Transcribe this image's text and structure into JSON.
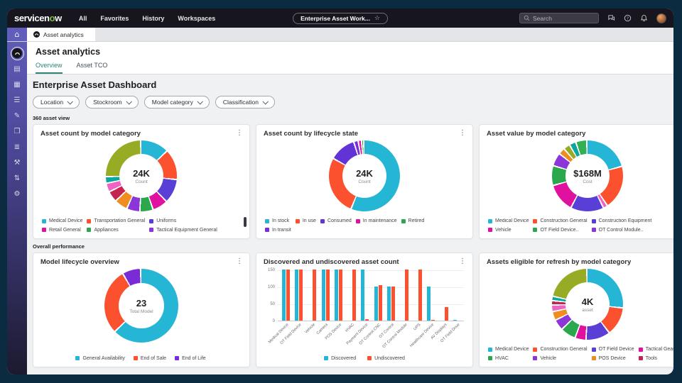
{
  "header": {
    "logo_pre": "servicen",
    "logo_o": "o",
    "logo_post": "w",
    "nav_items": [
      "All",
      "Favorites",
      "History",
      "Workspaces"
    ],
    "workspace_pill": "Enterprise Asset Work...",
    "search_placeholder": "Search",
    "right_icons": [
      "chat",
      "help",
      "notifications"
    ]
  },
  "tab_strip": {
    "active_tab": "Asset analytics"
  },
  "sidebar": {
    "items": [
      {
        "name": "asset-analytics-app",
        "type": "app"
      },
      {
        "name": "forms",
        "glyph": "▤"
      },
      {
        "name": "tasks",
        "glyph": "▦"
      },
      {
        "name": "sliders",
        "glyph": "☰"
      },
      {
        "name": "compose",
        "glyph": "✎"
      },
      {
        "name": "knowledge",
        "glyph": "❒"
      },
      {
        "name": "lists",
        "glyph": "≣"
      },
      {
        "name": "tools",
        "glyph": "⚒"
      },
      {
        "name": "transfers",
        "glyph": "⇅"
      },
      {
        "name": "settings",
        "glyph": "⚙"
      }
    ]
  },
  "icons": {
    "kebab": "⋮",
    "star": "☆",
    "home": "⌂"
  },
  "colors": {
    "frame": "#0B2B40",
    "header_bg": "#17161E",
    "accent_teal": "#2E8575",
    "cyan": "#25B6D6",
    "red": "#FB512F"
  },
  "page": {
    "title": "Asset analytics",
    "tabs": [
      {
        "label": "Overview",
        "active": true
      },
      {
        "label": "Asset TCO",
        "active": false
      }
    ],
    "dashboard_title": "Enterprise Asset Dashboard",
    "filters": [
      "Location",
      "Stockroom",
      "Model category",
      "Classification"
    ],
    "sections": [
      "360 asset view",
      "Overall performance"
    ]
  },
  "cards": [
    {
      "row": 1,
      "title": "Asset count by model category",
      "scrollbar": true,
      "chart_data": {
        "type": "donut",
        "center_value": "24K",
        "center_label": "Count",
        "size": 100,
        "segments": [
          {
            "color": "#25B6D6",
            "value": 13
          },
          {
            "color": "#FB512F",
            "value": 14
          },
          {
            "color": "#5A3FD6",
            "value": 11
          },
          {
            "color": "#E0119E",
            "value": 7
          },
          {
            "color": "#2BA84E",
            "value": 6
          },
          {
            "color": "#8A36D9",
            "value": 6
          },
          {
            "color": "#EF8D20",
            "value": 6
          },
          {
            "color": "#C2254F",
            "value": 5
          },
          {
            "color": "#EF63C2",
            "value": 4
          },
          {
            "color": "#0AA79F",
            "value": 3
          },
          {
            "color": "#97AB24",
            "value": 25
          }
        ],
        "legend_cols": 3,
        "legend": [
          {
            "label": "Medical Device",
            "color": "#25B6D6"
          },
          {
            "label": "Transportation General",
            "color": "#FB512F"
          },
          {
            "label": "Uniforms",
            "color": "#5A3FD6"
          },
          {
            "label": "Retail General",
            "color": "#E0119E"
          },
          {
            "label": "Appliances",
            "color": "#2BA84E"
          },
          {
            "label": "Tactical Equipment General",
            "color": "#8A36D9"
          }
        ]
      }
    },
    {
      "row": 1,
      "title": "Asset count by lifecycle state",
      "scrollbar": false,
      "chart_data": {
        "type": "donut",
        "center_value": "24K",
        "center_label": "Count",
        "size": 100,
        "segments": [
          {
            "color": "#25B6D6",
            "value": 56.5
          },
          {
            "color": "#FB512F",
            "value": 27
          },
          {
            "color": "#6233D6",
            "value": 12
          },
          {
            "color": "#7D2BD8",
            "value": 2
          },
          {
            "color": "#E0119E",
            "value": 1.5
          },
          {
            "color": "#2BA84E",
            "value": 1
          }
        ],
        "legend_cols": 5,
        "legend": [
          {
            "label": "In stock",
            "color": "#25B6D6"
          },
          {
            "label": "In use",
            "color": "#FB512F"
          },
          {
            "label": "Consumed",
            "color": "#6233D6"
          },
          {
            "label": "In maintenance",
            "color": "#E0119E"
          },
          {
            "label": "Retired",
            "color": "#2BA84E"
          },
          {
            "label": "In transit",
            "color": "#7D2BD8"
          }
        ]
      }
    },
    {
      "row": 1,
      "title": "Asset value by model category",
      "scrollbar": true,
      "legend_clip": true,
      "chart_data": {
        "type": "donut",
        "center_value": "$168M",
        "center_label": "Cost",
        "size": 100,
        "segments": [
          {
            "color": "#25B6D6",
            "value": 21
          },
          {
            "color": "#FB512F",
            "value": 20
          },
          {
            "color": "#EF63C2",
            "value": 2
          },
          {
            "color": "#5A3FD6",
            "value": 15
          },
          {
            "color": "#E0119E",
            "value": 13
          },
          {
            "color": "#2BA84E",
            "value": 9
          },
          {
            "color": "#8A36D9",
            "value": 6
          },
          {
            "color": "#EF8D20",
            "value": 3
          },
          {
            "color": "#97AB24",
            "value": 3
          },
          {
            "color": "#0AA79F",
            "value": 3
          },
          {
            "color": "#33B054",
            "value": 5
          }
        ],
        "legend_cols": 3,
        "legend": [
          {
            "label": "Medical Device",
            "color": "#25B6D6"
          },
          {
            "label": "Construction General",
            "color": "#FB512F"
          },
          {
            "label": "Construction Equipment",
            "color": "#5A3FD6"
          },
          {
            "label": "Vehicle",
            "color": "#E0119E"
          },
          {
            "label": "OT Field Device..",
            "color": "#2BA84E"
          },
          {
            "label": "OT Control Module..",
            "color": "#8A36D9"
          }
        ]
      }
    },
    {
      "row": 2,
      "title": "Model lifecycle overview",
      "scrollbar": false,
      "legend_center": true,
      "chart_data": {
        "type": "donut",
        "center_value": "23",
        "center_label": "Total Model",
        "size": 104,
        "segments": [
          {
            "color": "#25B6D6",
            "value": 63
          },
          {
            "color": "#FB512F",
            "value": 29
          },
          {
            "color": "#7A2BD8",
            "value": 8
          }
        ],
        "legend_cols": 3,
        "legend": [
          {
            "label": "General Availability",
            "color": "#25B6D6"
          },
          {
            "label": "End of Sale",
            "color": "#FB512F"
          },
          {
            "label": "End of Life",
            "color": "#7A2BD8"
          }
        ]
      }
    },
    {
      "row": 2,
      "title": "Discovered and undiscovered asset count",
      "scrollbar": false,
      "chart_data": {
        "type": "bar",
        "categories": [
          "Medical Device",
          "OT Field Device",
          "Vehicle",
          "Camera",
          "POS Device",
          "HVAC",
          "Payment Device",
          "OT Control CNC",
          "OT Control",
          "OT Control Module",
          "UPS",
          "Healthcare Device",
          "AV Displays",
          "OT Field Drive"
        ],
        "series": [
          {
            "name": "Discovered",
            "color": "#25B6D6",
            "values": [
              150,
              150,
              0,
              150,
              150,
              0,
              150,
              100,
              100,
              0,
              0,
              100,
              0,
              3
            ]
          },
          {
            "name": "Undiscovered",
            "color": "#FB512F",
            "values": [
              150,
              150,
              150,
              150,
              150,
              150,
              5,
              105,
              100,
              150,
              150,
              2,
              40,
              0
            ]
          }
        ],
        "yticks": [
          0,
          50,
          100,
          150
        ],
        "ylim": [
          0,
          150
        ],
        "legend_position": "bottom"
      }
    },
    {
      "row": 2,
      "title": "Assets eligible for refresh by model category",
      "scrollbar": true,
      "chart_data": {
        "type": "donut",
        "center_value": "4K",
        "center_label": "asset",
        "size": 100,
        "segments": [
          {
            "color": "#25B6D6",
            "value": 27
          },
          {
            "color": "#FB512F",
            "value": 13
          },
          {
            "color": "#5A3FD6",
            "value": 11
          },
          {
            "color": "#E0119E",
            "value": 5
          },
          {
            "color": "#2BA84E",
            "value": 7
          },
          {
            "color": "#8A36D9",
            "value": 5
          },
          {
            "color": "#EF8D20",
            "value": 4
          },
          {
            "color": "#EF63C2",
            "value": 3
          },
          {
            "color": "#C2254F",
            "value": 2
          },
          {
            "color": "#0AA79F",
            "value": 2
          },
          {
            "color": "#97AB24",
            "value": 21
          }
        ],
        "legend_cols": 4,
        "legend": [
          {
            "label": "Medical Device",
            "color": "#25B6D6"
          },
          {
            "label": "Construction General",
            "color": "#FB512F"
          },
          {
            "label": "OT Field Device",
            "color": "#5A3FD6"
          },
          {
            "label": "Tactical Gear",
            "color": "#E0119E"
          },
          {
            "label": "HVAC",
            "color": "#2BA84E"
          },
          {
            "label": "Vehicle",
            "color": "#8A36D9"
          },
          {
            "label": "POS Device",
            "color": "#EF8D20"
          },
          {
            "label": "Tools",
            "color": "#C2254F"
          }
        ]
      }
    }
  ]
}
